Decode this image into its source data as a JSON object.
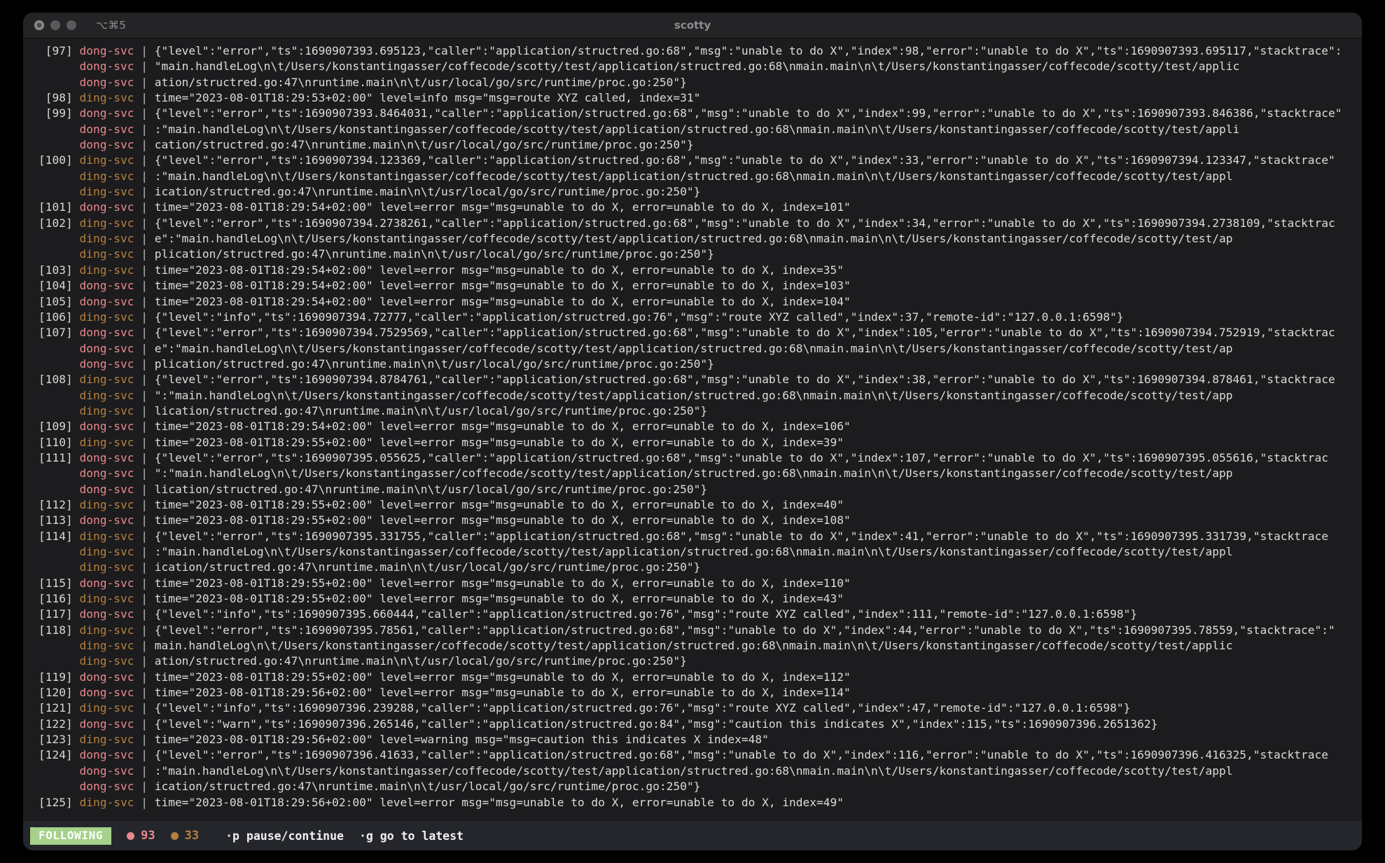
{
  "window": {
    "title": "scotty",
    "shortcut": "⌥⌘5",
    "traffic_lights": [
      "close-button",
      "minimize-button",
      "zoom-button"
    ]
  },
  "colors": {
    "background": "#1c1c1e",
    "titlebar": "#242426",
    "statusbar": "#24262c",
    "service_dong": "#e8898c",
    "service_ding": "#b5803f",
    "following_badge": "#a5d18a",
    "text": "#d8d8d8"
  },
  "status": {
    "mode_label": "FOLLOWING",
    "error_count": "93",
    "warn_count": "33",
    "hints": [
      {
        "key": "·p",
        "label": "pause/continue"
      },
      {
        "key": "·g",
        "label": "go to latest"
      }
    ]
  },
  "log": {
    "lines": [
      {
        "index": "[97]",
        "svc": "dong-svc",
        "svc_kind": "dong",
        "msg": "{\"level\":\"error\",\"ts\":1690907393.695123,\"caller\":\"application/structred.go:68\",\"msg\":\"unable to do X\",\"index\":98,\"error\":\"unable to do X\",\"ts\":1690907393.695117,\"stacktrace\":"
      },
      {
        "index": "",
        "svc": "dong-svc",
        "svc_kind": "dong",
        "msg": "\"main.handleLog\\n\\t/Users/konstantingasser/coffecode/scotty/test/application/structred.go:68\\nmain.main\\n\\t/Users/konstantingasser/coffecode/scotty/test/applic"
      },
      {
        "index": "",
        "svc": "dong-svc",
        "svc_kind": "dong",
        "msg": "ation/structred.go:47\\nruntime.main\\n\\t/usr/local/go/src/runtime/proc.go:250\"}"
      },
      {
        "index": "[98]",
        "svc": "ding-svc",
        "svc_kind": "ding",
        "msg": "time=\"2023-08-01T18:29:53+02:00\" level=info msg=\"msg=route XYZ called, index=31\""
      },
      {
        "index": "[99]",
        "svc": "dong-svc",
        "svc_kind": "dong",
        "msg": "{\"level\":\"error\",\"ts\":1690907393.8464031,\"caller\":\"application/structred.go:68\",\"msg\":\"unable to do X\",\"index\":99,\"error\":\"unable to do X\",\"ts\":1690907393.846386,\"stacktrace\""
      },
      {
        "index": "",
        "svc": "dong-svc",
        "svc_kind": "dong",
        "msg": ":\"main.handleLog\\n\\t/Users/konstantingasser/coffecode/scotty/test/application/structred.go:68\\nmain.main\\n\\t/Users/konstantingasser/coffecode/scotty/test/appli"
      },
      {
        "index": "",
        "svc": "dong-svc",
        "svc_kind": "dong",
        "msg": "cation/structred.go:47\\nruntime.main\\n\\t/usr/local/go/src/runtime/proc.go:250\"}"
      },
      {
        "index": "[100]",
        "svc": "ding-svc",
        "svc_kind": "ding",
        "msg": "{\"level\":\"error\",\"ts\":1690907394.123369,\"caller\":\"application/structred.go:68\",\"msg\":\"unable to do X\",\"index\":33,\"error\":\"unable to do X\",\"ts\":1690907394.123347,\"stacktrace\""
      },
      {
        "index": "",
        "svc": "ding-svc",
        "svc_kind": "ding",
        "msg": ":\"main.handleLog\\n\\t/Users/konstantingasser/coffecode/scotty/test/application/structred.go:68\\nmain.main\\n\\t/Users/konstantingasser/coffecode/scotty/test/appl"
      },
      {
        "index": "",
        "svc": "ding-svc",
        "svc_kind": "ding",
        "msg": "ication/structred.go:47\\nruntime.main\\n\\t/usr/local/go/src/runtime/proc.go:250\"}"
      },
      {
        "index": "[101]",
        "svc": "dong-svc",
        "svc_kind": "dong",
        "msg": "time=\"2023-08-01T18:29:54+02:00\" level=error msg=\"msg=unable to do X, error=unable to do X, index=101\""
      },
      {
        "index": "[102]",
        "svc": "ding-svc",
        "svc_kind": "ding",
        "msg": "{\"level\":\"error\",\"ts\":1690907394.2738261,\"caller\":\"application/structred.go:68\",\"msg\":\"unable to do X\",\"index\":34,\"error\":\"unable to do X\",\"ts\":1690907394.2738109,\"stacktrac"
      },
      {
        "index": "",
        "svc": "ding-svc",
        "svc_kind": "ding",
        "msg": "e\":\"main.handleLog\\n\\t/Users/konstantingasser/coffecode/scotty/test/application/structred.go:68\\nmain.main\\n\\t/Users/konstantingasser/coffecode/scotty/test/ap"
      },
      {
        "index": "",
        "svc": "ding-svc",
        "svc_kind": "ding",
        "msg": "plication/structred.go:47\\nruntime.main\\n\\t/usr/local/go/src/runtime/proc.go:250\"}"
      },
      {
        "index": "[103]",
        "svc": "ding-svc",
        "svc_kind": "ding",
        "msg": "time=\"2023-08-01T18:29:54+02:00\" level=error msg=\"msg=unable to do X, error=unable to do X, index=35\""
      },
      {
        "index": "[104]",
        "svc": "dong-svc",
        "svc_kind": "dong",
        "msg": "time=\"2023-08-01T18:29:54+02:00\" level=error msg=\"msg=unable to do X, error=unable to do X, index=103\""
      },
      {
        "index": "[105]",
        "svc": "dong-svc",
        "svc_kind": "dong",
        "msg": "time=\"2023-08-01T18:29:54+02:00\" level=error msg=\"msg=unable to do X, error=unable to do X, index=104\""
      },
      {
        "index": "[106]",
        "svc": "ding-svc",
        "svc_kind": "ding",
        "msg": "{\"level\":\"info\",\"ts\":1690907394.72777,\"caller\":\"application/structred.go:76\",\"msg\":\"route XYZ called\",\"index\":37,\"remote-id\":\"127.0.0.1:6598\"}"
      },
      {
        "index": "[107]",
        "svc": "dong-svc",
        "svc_kind": "dong",
        "msg": "{\"level\":\"error\",\"ts\":1690907394.7529569,\"caller\":\"application/structred.go:68\",\"msg\":\"unable to do X\",\"index\":105,\"error\":\"unable to do X\",\"ts\":1690907394.752919,\"stacktrac"
      },
      {
        "index": "",
        "svc": "dong-svc",
        "svc_kind": "dong",
        "msg": "e\":\"main.handleLog\\n\\t/Users/konstantingasser/coffecode/scotty/test/application/structred.go:68\\nmain.main\\n\\t/Users/konstantingasser/coffecode/scotty/test/ap"
      },
      {
        "index": "",
        "svc": "dong-svc",
        "svc_kind": "dong",
        "msg": "plication/structred.go:47\\nruntime.main\\n\\t/usr/local/go/src/runtime/proc.go:250\"}"
      },
      {
        "index": "[108]",
        "svc": "ding-svc",
        "svc_kind": "ding",
        "msg": "{\"level\":\"error\",\"ts\":1690907394.8784761,\"caller\":\"application/structred.go:68\",\"msg\":\"unable to do X\",\"index\":38,\"error\":\"unable to do X\",\"ts\":1690907394.878461,\"stacktrace"
      },
      {
        "index": "",
        "svc": "ding-svc",
        "svc_kind": "ding",
        "msg": "\":\"main.handleLog\\n\\t/Users/konstantingasser/coffecode/scotty/test/application/structred.go:68\\nmain.main\\n\\t/Users/konstantingasser/coffecode/scotty/test/app"
      },
      {
        "index": "",
        "svc": "ding-svc",
        "svc_kind": "ding",
        "msg": "lication/structred.go:47\\nruntime.main\\n\\t/usr/local/go/src/runtime/proc.go:250\"}"
      },
      {
        "index": "[109]",
        "svc": "dong-svc",
        "svc_kind": "dong",
        "msg": "time=\"2023-08-01T18:29:54+02:00\" level=error msg=\"msg=unable to do X, error=unable to do X, index=106\""
      },
      {
        "index": "[110]",
        "svc": "ding-svc",
        "svc_kind": "ding",
        "msg": "time=\"2023-08-01T18:29:55+02:00\" level=error msg=\"msg=unable to do X, error=unable to do X, index=39\""
      },
      {
        "index": "[111]",
        "svc": "dong-svc",
        "svc_kind": "dong",
        "msg": "{\"level\":\"error\",\"ts\":1690907395.055625,\"caller\":\"application/structred.go:68\",\"msg\":\"unable to do X\",\"index\":107,\"error\":\"unable to do X\",\"ts\":1690907395.055616,\"stacktrac"
      },
      {
        "index": "",
        "svc": "dong-svc",
        "svc_kind": "dong",
        "msg": "\":\"main.handleLog\\n\\t/Users/konstantingasser/coffecode/scotty/test/application/structred.go:68\\nmain.main\\n\\t/Users/konstantingasser/coffecode/scotty/test/app"
      },
      {
        "index": "",
        "svc": "dong-svc",
        "svc_kind": "dong",
        "msg": "lication/structred.go:47\\nruntime.main\\n\\t/usr/local/go/src/runtime/proc.go:250\"}"
      },
      {
        "index": "[112]",
        "svc": "ding-svc",
        "svc_kind": "ding",
        "msg": "time=\"2023-08-01T18:29:55+02:00\" level=error msg=\"msg=unable to do X, error=unable to do X, index=40\""
      },
      {
        "index": "[113]",
        "svc": "dong-svc",
        "svc_kind": "dong",
        "msg": "time=\"2023-08-01T18:29:55+02:00\" level=error msg=\"msg=unable to do X, error=unable to do X, index=108\""
      },
      {
        "index": "[114]",
        "svc": "ding-svc",
        "svc_kind": "ding",
        "msg": "{\"level\":\"error\",\"ts\":1690907395.331755,\"caller\":\"application/structred.go:68\",\"msg\":\"unable to do X\",\"index\":41,\"error\":\"unable to do X\",\"ts\":1690907395.331739,\"stacktrace"
      },
      {
        "index": "",
        "svc": "ding-svc",
        "svc_kind": "ding",
        "msg": ":\"main.handleLog\\n\\t/Users/konstantingasser/coffecode/scotty/test/application/structred.go:68\\nmain.main\\n\\t/Users/konstantingasser/coffecode/scotty/test/appl"
      },
      {
        "index": "",
        "svc": "ding-svc",
        "svc_kind": "ding",
        "msg": "ication/structred.go:47\\nruntime.main\\n\\t/usr/local/go/src/runtime/proc.go:250\"}"
      },
      {
        "index": "[115]",
        "svc": "dong-svc",
        "svc_kind": "dong",
        "msg": "time=\"2023-08-01T18:29:55+02:00\" level=error msg=\"msg=unable to do X, error=unable to do X, index=110\""
      },
      {
        "index": "[116]",
        "svc": "ding-svc",
        "svc_kind": "ding",
        "msg": "time=\"2023-08-01T18:29:55+02:00\" level=error msg=\"msg=unable to do X, error=unable to do X, index=43\""
      },
      {
        "index": "[117]",
        "svc": "dong-svc",
        "svc_kind": "dong",
        "msg": "{\"level\":\"info\",\"ts\":1690907395.660444,\"caller\":\"application/structred.go:76\",\"msg\":\"route XYZ called\",\"index\":111,\"remote-id\":\"127.0.0.1:6598\"}"
      },
      {
        "index": "[118]",
        "svc": "ding-svc",
        "svc_kind": "ding",
        "msg": "{\"level\":\"error\",\"ts\":1690907395.78561,\"caller\":\"application/structred.go:68\",\"msg\":\"unable to do X\",\"index\":44,\"error\":\"unable to do X\",\"ts\":1690907395.78559,\"stacktrace\":\""
      },
      {
        "index": "",
        "svc": "ding-svc",
        "svc_kind": "ding",
        "msg": "main.handleLog\\n\\t/Users/konstantingasser/coffecode/scotty/test/application/structred.go:68\\nmain.main\\n\\t/Users/konstantingasser/coffecode/scotty/test/applic"
      },
      {
        "index": "",
        "svc": "ding-svc",
        "svc_kind": "ding",
        "msg": "ation/structred.go:47\\nruntime.main\\n\\t/usr/local/go/src/runtime/proc.go:250\"}"
      },
      {
        "index": "[119]",
        "svc": "dong-svc",
        "svc_kind": "dong",
        "msg": "time=\"2023-08-01T18:29:55+02:00\" level=error msg=\"msg=unable to do X, error=unable to do X, index=112\""
      },
      {
        "index": "[120]",
        "svc": "dong-svc",
        "svc_kind": "dong",
        "msg": "time=\"2023-08-01T18:29:56+02:00\" level=error msg=\"msg=unable to do X, error=unable to do X, index=114\""
      },
      {
        "index": "[121]",
        "svc": "ding-svc",
        "svc_kind": "ding",
        "msg": "{\"level\":\"info\",\"ts\":1690907396.239288,\"caller\":\"application/structred.go:76\",\"msg\":\"route XYZ called\",\"index\":47,\"remote-id\":\"127.0.0.1:6598\"}"
      },
      {
        "index": "[122]",
        "svc": "dong-svc",
        "svc_kind": "dong",
        "msg": "{\"level\":\"warn\",\"ts\":1690907396.265146,\"caller\":\"application/structred.go:84\",\"msg\":\"caution this indicates X\",\"index\":115,\"ts\":1690907396.2651362}"
      },
      {
        "index": "[123]",
        "svc": "ding-svc",
        "svc_kind": "ding",
        "msg": "time=\"2023-08-01T18:29:56+02:00\" level=warning msg=\"msg=caution this indicates X index=48\""
      },
      {
        "index": "[124]",
        "svc": "dong-svc",
        "svc_kind": "dong",
        "msg": "{\"level\":\"error\",\"ts\":1690907396.41633,\"caller\":\"application/structred.go:68\",\"msg\":\"unable to do X\",\"index\":116,\"error\":\"unable to do X\",\"ts\":1690907396.416325,\"stacktrace"
      },
      {
        "index": "",
        "svc": "dong-svc",
        "svc_kind": "dong",
        "msg": ":\"main.handleLog\\n\\t/Users/konstantingasser/coffecode/scotty/test/application/structred.go:68\\nmain.main\\n\\t/Users/konstantingasser/coffecode/scotty/test/appl"
      },
      {
        "index": "",
        "svc": "dong-svc",
        "svc_kind": "dong",
        "msg": "ication/structred.go:47\\nruntime.main\\n\\t/usr/local/go/src/runtime/proc.go:250\"}"
      },
      {
        "index": "[125]",
        "svc": "ding-svc",
        "svc_kind": "ding",
        "msg": "time=\"2023-08-01T18:29:56+02:00\" level=error msg=\"msg=unable to do X, error=unable to do X, index=49\""
      }
    ]
  }
}
